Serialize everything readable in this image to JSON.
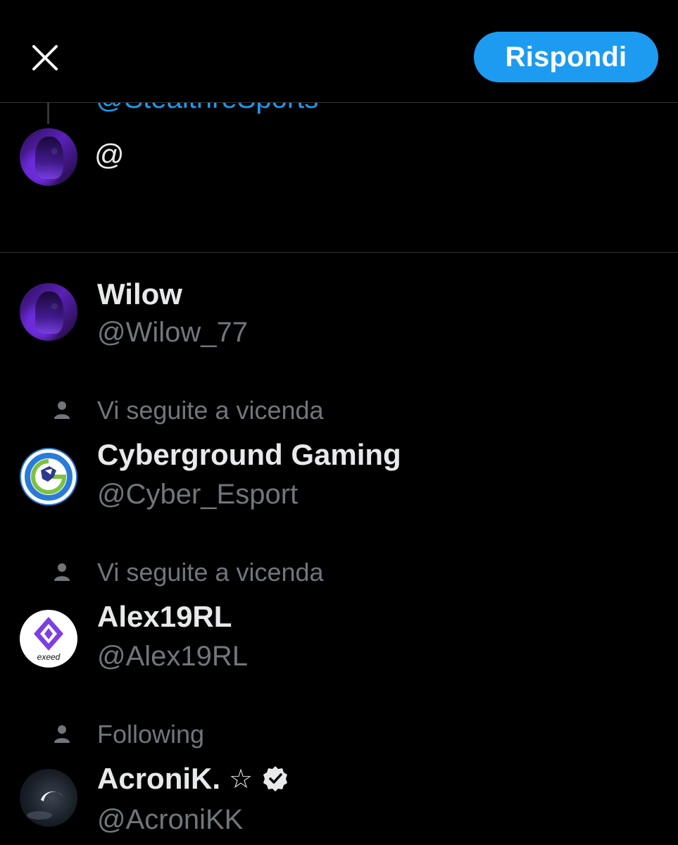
{
  "header": {
    "reply_label": "Rispondi"
  },
  "compose": {
    "replying_to": "@StealthreSports",
    "input_value": "@"
  },
  "suggestions": [
    {
      "context": "",
      "name": "Wilow",
      "handle": "@Wilow_77",
      "avatar_icon": "purple-avatar"
    },
    {
      "context": "Vi seguite a vicenda",
      "name": "Cyberground Gaming",
      "handle": "@Cyber_Esport",
      "avatar_icon": "cyberground-logo"
    },
    {
      "context": "Vi seguite a vicenda",
      "name": "Alex19RL",
      "handle": "@Alex19RL",
      "avatar_icon": "exeed-logo",
      "avatar_text": "exeed"
    },
    {
      "context": "Following",
      "name": "AcroniK.",
      "name_suffix": "☆",
      "handle": "@AcroniKK",
      "verified": true,
      "avatar_icon": "eclipse-avatar"
    }
  ],
  "colors": {
    "background": "#000000",
    "accent": "#1d9bf0",
    "primary_text": "#e7e9ea",
    "secondary_text": "#71767b",
    "divider": "#2f3336"
  }
}
